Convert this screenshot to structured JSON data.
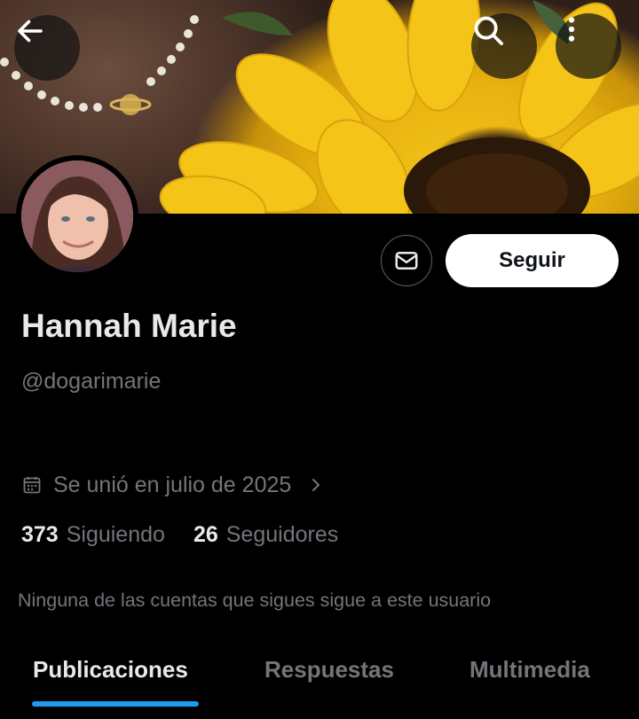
{
  "header": {
    "back_icon": "arrow-left-icon",
    "search_icon": "search-icon",
    "more_icon": "more-vertical-icon"
  },
  "profile": {
    "name": "Hannah Marie",
    "handle": "@dogarimarie",
    "joined": "Se unió en julio de 2025",
    "following_count": "373",
    "following_label": "Siguiendo",
    "followers_count": "26",
    "followers_label": "Seguidores",
    "mutual_note": "Ninguna de las cuentas que sigues sigue a este usuario"
  },
  "actions": {
    "message_icon": "mail-icon",
    "follow_label": "Seguir"
  },
  "tabs": [
    {
      "label": "Publicaciones",
      "active": true
    },
    {
      "label": "Respuestas",
      "active": false
    },
    {
      "label": "Multimedia",
      "active": false
    }
  ],
  "colors": {
    "accent": "#1d9bf0",
    "muted_text": "#71767b",
    "primary_text": "#e7e9ea",
    "background": "#000000"
  }
}
